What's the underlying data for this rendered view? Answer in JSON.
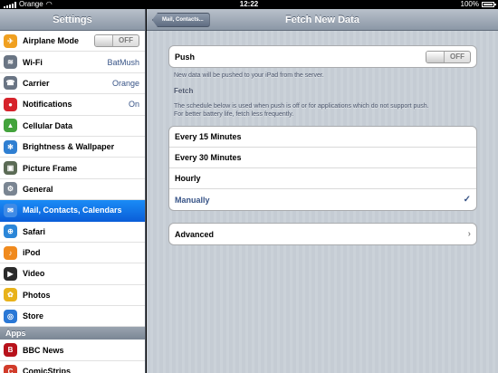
{
  "status_bar": {
    "carrier": "Orange",
    "time": "12:22",
    "battery_text": "100%",
    "battery_level": 1.0
  },
  "sidebar": {
    "title": "Settings",
    "items": [
      {
        "label": "Airplane Mode",
        "icon": "airplane-icon",
        "icon_color": "#f0a020",
        "switch_text": "OFF",
        "glyph": "✈"
      },
      {
        "label": "Wi-Fi",
        "icon": "wifi-icon",
        "icon_color": "#6a7584",
        "value": "BatMush",
        "glyph": "≋"
      },
      {
        "label": "Carrier",
        "icon": "phone-icon",
        "icon_color": "#6a7584",
        "value": "Orange",
        "glyph": "☎"
      },
      {
        "label": "Notifications",
        "icon": "notifications-icon",
        "icon_color": "#d6232b",
        "value": "On",
        "glyph": "●"
      },
      {
        "label": "Cellular Data",
        "icon": "cellular-icon",
        "icon_color": "#43a33c",
        "glyph": "▲"
      },
      {
        "label": "Brightness & Wallpaper",
        "icon": "brightness-icon",
        "icon_color": "#2f7fd2",
        "glyph": "✻"
      },
      {
        "label": "Picture Frame",
        "icon": "picture-frame-icon",
        "icon_color": "#5b6b55",
        "glyph": "▣"
      },
      {
        "label": "General",
        "icon": "gear-icon",
        "icon_color": "#7a8592",
        "glyph": "⚙"
      },
      {
        "label": "Mail, Contacts, Calendars",
        "icon": "mail-icon",
        "icon_color": "#3f8be6",
        "glyph": "✉",
        "selected": true
      },
      {
        "label": "Safari",
        "icon": "safari-icon",
        "icon_color": "#2b86d8",
        "glyph": "⊕"
      },
      {
        "label": "iPod",
        "icon": "ipod-icon",
        "icon_color": "#f08a1e",
        "glyph": "♪"
      },
      {
        "label": "Video",
        "icon": "video-icon",
        "icon_color": "#2a2a2a",
        "glyph": "▶"
      },
      {
        "label": "Photos",
        "icon": "photos-icon",
        "icon_color": "#e8b21a",
        "glyph": "✿"
      },
      {
        "label": "Store",
        "icon": "store-icon",
        "icon_color": "#2a78d6",
        "glyph": "◎"
      }
    ],
    "apps_section_label": "Apps",
    "apps": [
      {
        "label": "BBC News",
        "icon": "bbc-news-icon",
        "icon_color": "#b8121b",
        "glyph": "B"
      },
      {
        "label": "ComicStrips",
        "icon": "comicstrips-icon",
        "icon_color": "#d13b2a",
        "glyph": "C"
      }
    ]
  },
  "detail": {
    "title": "Fetch New Data",
    "back_label": "Mail, Contacts...",
    "push": {
      "label": "Push",
      "switch_text": "OFF",
      "note": "New data will be pushed to your iPad from the server."
    },
    "fetch": {
      "label": "Fetch",
      "note_line1": "The schedule below is used when push is off or for applications which do not support push.",
      "note_line2": "For better battery life, fetch less frequently.",
      "options": [
        {
          "label": "Every 15 Minutes",
          "checked": false
        },
        {
          "label": "Every 30 Minutes",
          "checked": false
        },
        {
          "label": "Hourly",
          "checked": false
        },
        {
          "label": "Manually",
          "checked": true
        }
      ],
      "check_glyph": "✓"
    },
    "advanced": {
      "label": "Advanced",
      "chevron": "›"
    }
  }
}
